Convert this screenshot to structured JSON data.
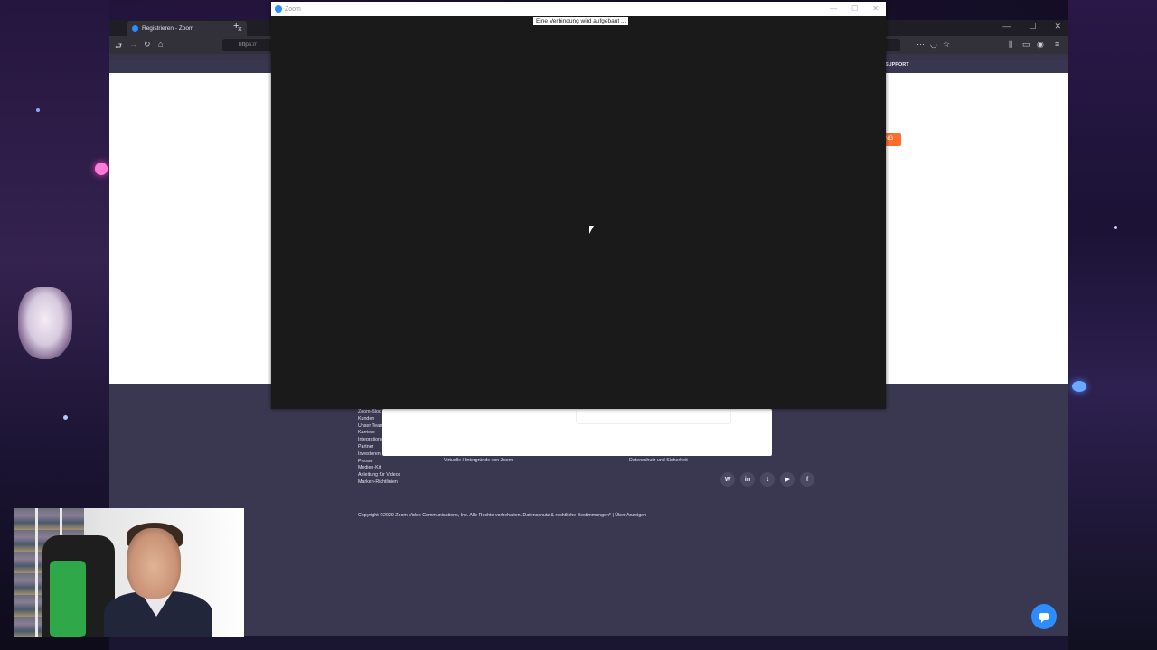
{
  "browser": {
    "tab_title": "Registrieren - Zoom",
    "new_tab": "+",
    "tab_close": "×",
    "url": "https://",
    "header_support": "SUPPORT",
    "signup_cta": "NG",
    "win_controls": [
      "—",
      "☐",
      "✕"
    ]
  },
  "footer": {
    "links": [
      "Zoom-Blog",
      "Kunden",
      "Unser Team",
      "Karriere",
      "Integrationen",
      "Partner",
      "Investoren",
      "Presse",
      "Medien-Kit",
      "Anleitung für Videos",
      "Marken-Richtlinien"
    ],
    "virtual_backgrounds": "Virtuelle Hintergründe von Zoom",
    "privacy_security": "Datenschutz und Sicherheit",
    "copyright": "Copyright ©2020 Zoom Video Communications, Inc. Alle Rechte vorbehalten.  Datenschutz & rechtliche Bestimmungen*  |  Über Anzeigen",
    "social": [
      "W",
      "in",
      "t",
      "▶",
      "f"
    ]
  },
  "zoom": {
    "title": "Zoom",
    "status": "Eine Verbindung wird aufgebaut ...",
    "controls": [
      "—",
      "☐",
      "✕"
    ]
  },
  "colors": {
    "zoom_blue": "#2d8cff",
    "zoom_orange": "#ff6d2d",
    "footer_bg": "#3a3751"
  }
}
